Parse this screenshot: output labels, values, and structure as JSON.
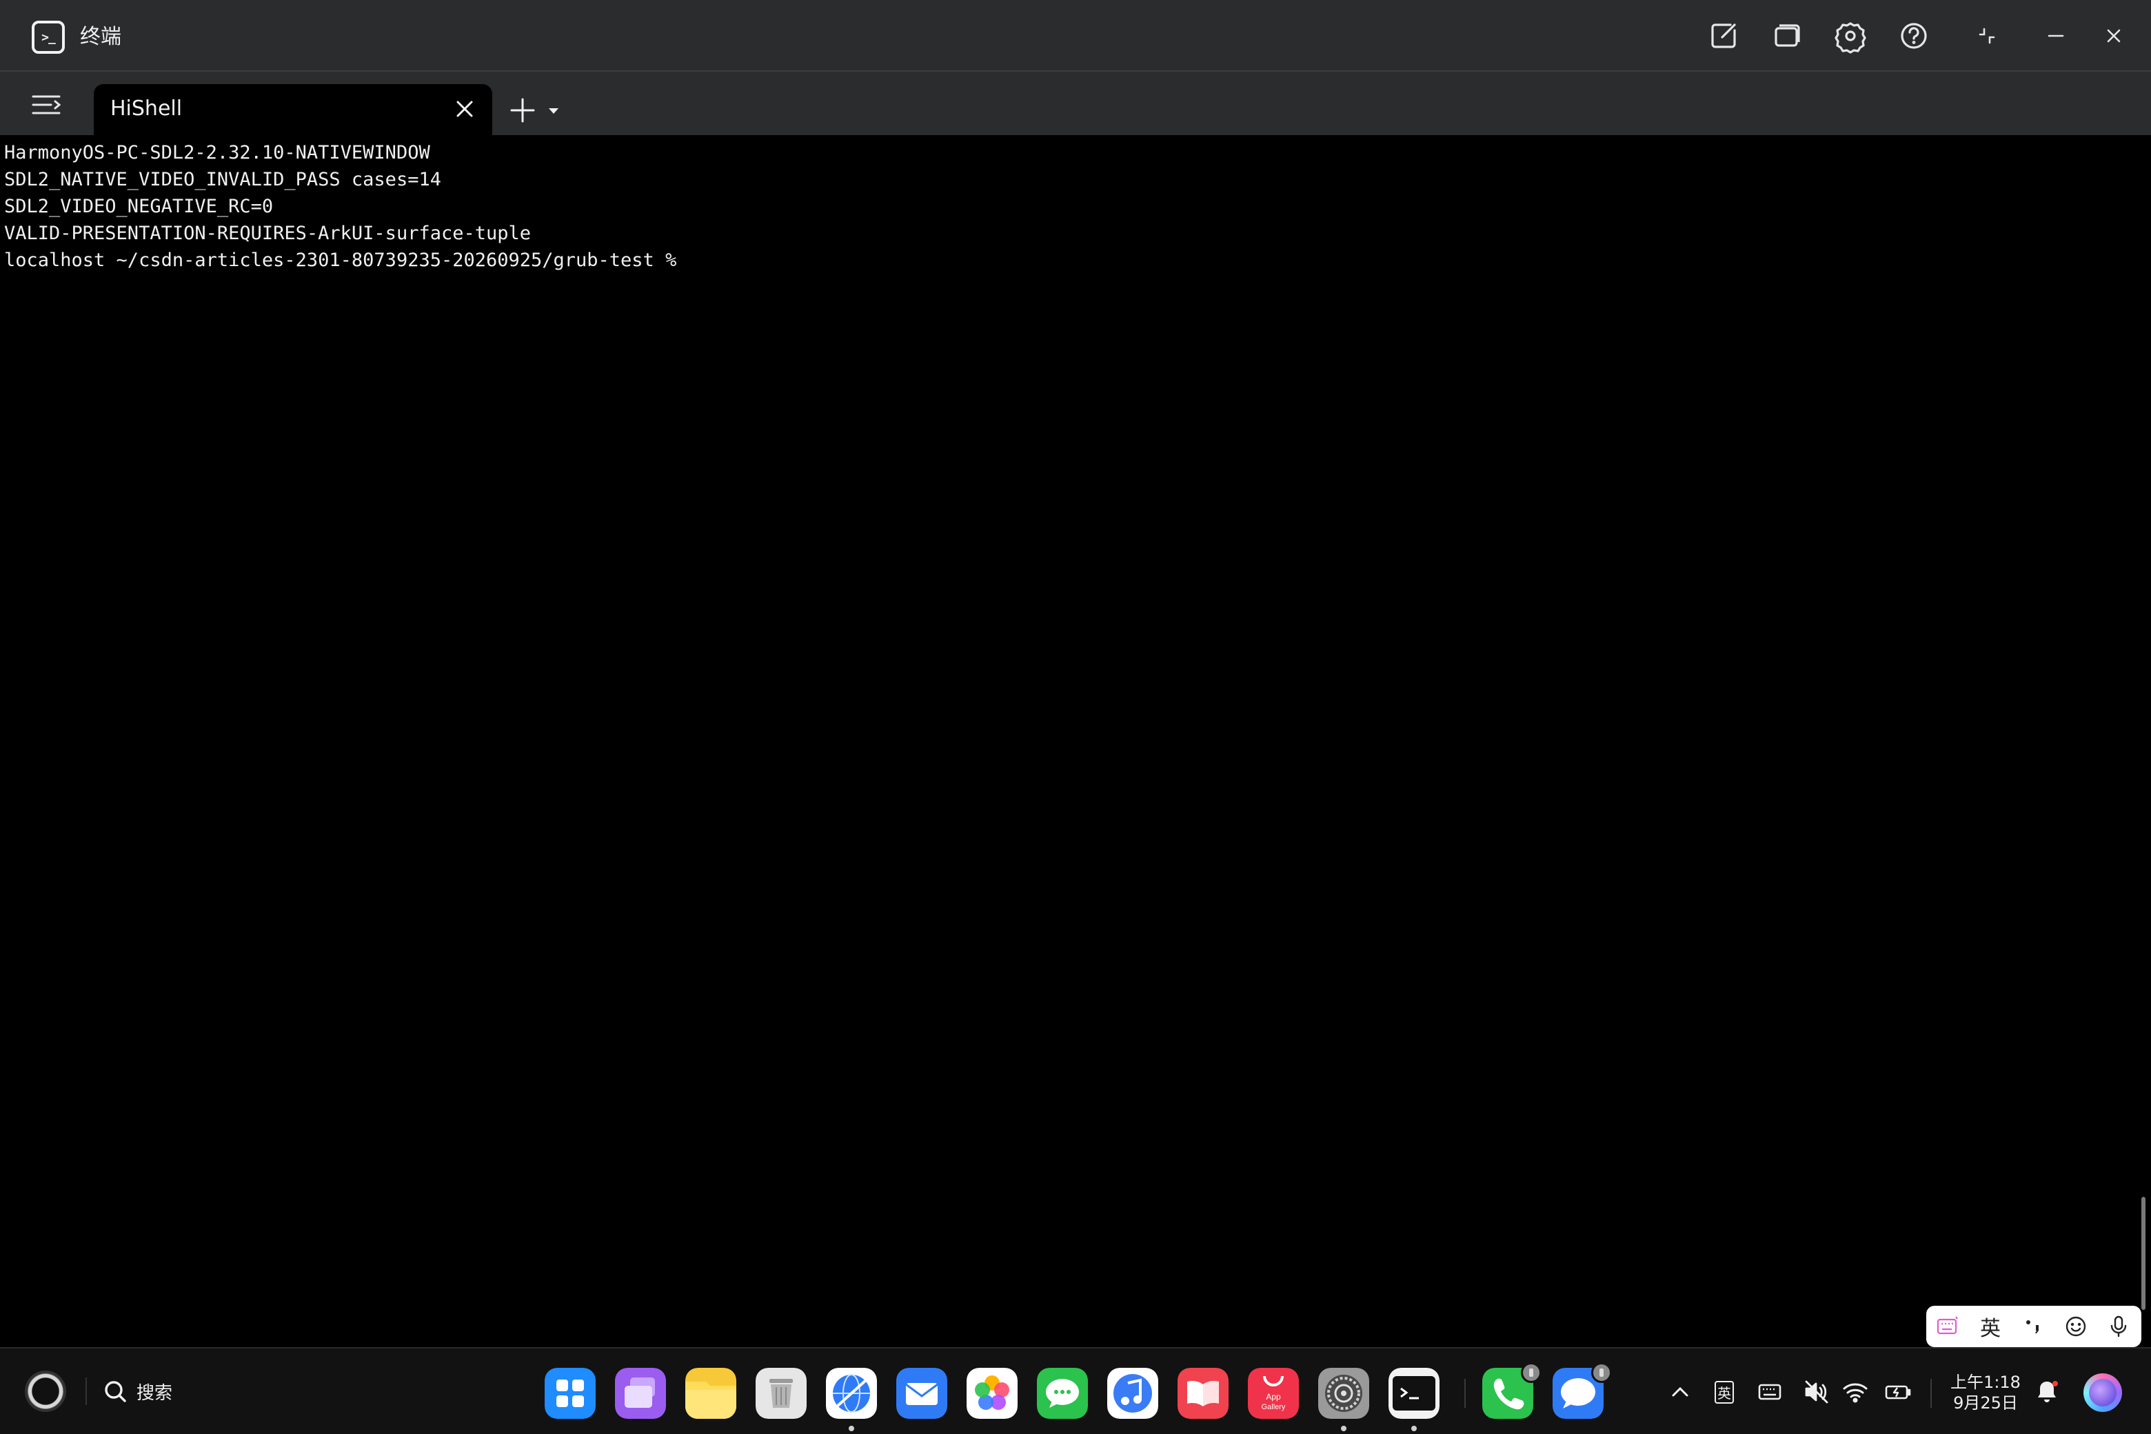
{
  "window": {
    "title": "终端",
    "controls": [
      "new-window-icon",
      "windows-icon",
      "gear-icon",
      "help-icon",
      "restore-icon",
      "minimize-icon",
      "close-icon"
    ]
  },
  "tabs": {
    "items": [
      {
        "label": "HiShell",
        "active": true
      }
    ],
    "add_icon": "plus-icon",
    "dropdown_icon": "caret-down-icon"
  },
  "terminal": {
    "lines": [
      "HarmonyOS-PC-SDL2-2.32.10-NATIVEWINDOW",
      "SDL2_NATIVE_VIDEO_INVALID_PASS cases=14",
      "SDL2_VIDEO_NEGATIVE_RC=0",
      "VALID-PRESENTATION-REQUIRES-ArkUI-surface-tuple",
      "localhost ~/csdn-articles-2301-80739235-20260925/grub-test %"
    ]
  },
  "ime": {
    "lang": "英",
    "items": [
      "keyboard-icon",
      "lang",
      "punctuation-icon",
      "emoji-icon",
      "mic-icon"
    ]
  },
  "taskbar": {
    "search_label": "搜索",
    "dock": [
      {
        "name": "launcher",
        "color": "#1f8cff",
        "running": false
      },
      {
        "name": "multitask",
        "color": "#9b5cf0",
        "running": false
      },
      {
        "name": "files",
        "color": "#f7c938",
        "running": false
      },
      {
        "name": "trash",
        "color": "#d8d8d8",
        "running": false
      },
      {
        "name": "browser",
        "color": "#2f7bf5",
        "running": true
      },
      {
        "name": "mail",
        "color": "#2f7bf5",
        "running": false
      },
      {
        "name": "photos",
        "color": "#ffffff",
        "running": false
      },
      {
        "name": "messages",
        "color": "#2bc24d",
        "running": false
      },
      {
        "name": "music",
        "color": "#3a7cf5",
        "running": false
      },
      {
        "name": "books",
        "color": "#f0434f",
        "running": false
      },
      {
        "name": "app-gallery",
        "color": "#f0334a",
        "label": "App Gallery",
        "running": false
      },
      {
        "name": "settings",
        "color": "#8c8c8c",
        "running": true
      },
      {
        "name": "terminal",
        "color": "#f2f2f2",
        "running": true
      },
      {
        "name": "phone",
        "color": "#2bc24d",
        "running": false,
        "badge": true
      },
      {
        "name": "chat",
        "color": "#2f7bf5",
        "running": false,
        "badge": true
      }
    ],
    "tray": {
      "ime_indicator": "英",
      "time": "上午1:18",
      "date": "9月25日"
    }
  }
}
